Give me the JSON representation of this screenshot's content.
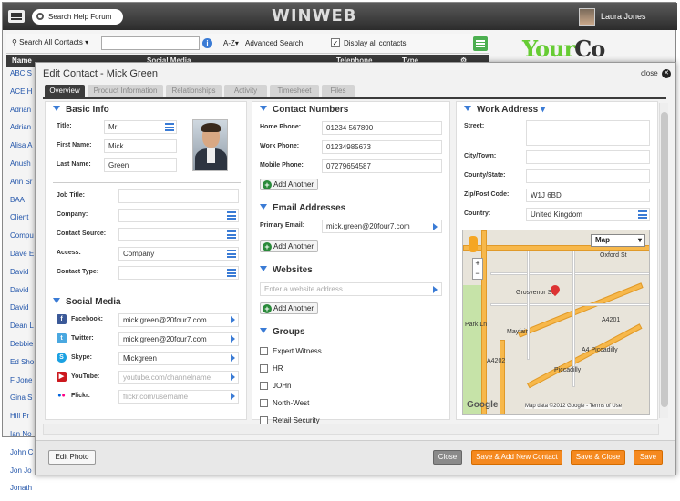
{
  "app": {
    "search_forum": "Search Help Forum",
    "logo": "WINWEB",
    "user_name": "Laura Jones",
    "brand_a": "Your",
    "brand_b": "Co"
  },
  "toolbar": {
    "search_label": "Search All Contacts",
    "az": "A-Z",
    "advanced": "Advanced Search",
    "display_all": "Display all contacts",
    "info": "i"
  },
  "grid": {
    "columns": [
      "Name",
      "Social Media",
      "Telephone",
      "Type"
    ],
    "names": [
      "ABC S",
      "ACE H",
      "Adrian",
      "Adrian",
      "Alisa A",
      "Anush",
      "Ann Sr",
      "BAA",
      "Client",
      "Compu",
      "Dave E",
      "David",
      "David",
      "David",
      "Dean L",
      "Debbie",
      "Ed Sho",
      "F Jone",
      "Gina S",
      "Hill Pr",
      "Ian No",
      "John C",
      "Jon Jo",
      "Jonath"
    ]
  },
  "modal": {
    "title": "Edit Contact - Mick Green",
    "close": "close",
    "tabs": [
      "Overview",
      "Product Information",
      "Relationships",
      "Activity",
      "Timesheet",
      "Files"
    ],
    "basic_info": {
      "title": "Basic Info",
      "title_label": "Title:",
      "title_value": "Mr",
      "first_name_label": "First Name:",
      "first_name": "Mick",
      "last_name_label": "Last Name:",
      "last_name": "Green",
      "job_title_label": "Job Title:",
      "company_label": "Company:",
      "contact_source_label": "Contact Source:",
      "access_label": "Access:",
      "access_value": "Company",
      "contact_type_label": "Contact Type:"
    },
    "social_media": {
      "title": "Social Media",
      "facebook_label": "Facebook:",
      "facebook": "mick.green@20four7.com",
      "twitter_label": "Twitter:",
      "twitter": "mick.green@20four7.com",
      "skype_label": "Skype:",
      "skype": "Mickgreen",
      "youtube_label": "YouTube:",
      "youtube_ph": "youtube.com/channelname",
      "flickr_label": "Flickr:",
      "flickr_ph": "flickr.com/username"
    },
    "contact_numbers": {
      "title": "Contact Numbers",
      "home_label": "Home Phone:",
      "home": "01234 567890",
      "work_label": "Work Phone:",
      "work": "01234985673",
      "mobile_label": "Mobile Phone:",
      "mobile": "07279654587",
      "add": "Add Another"
    },
    "email": {
      "title": "Email Addresses",
      "primary_label": "Primary Email:",
      "primary": "mick.green@20four7.com",
      "add": "Add Another"
    },
    "websites": {
      "title": "Websites",
      "placeholder": "Enter a website address",
      "add": "Add Another"
    },
    "groups": {
      "title": "Groups",
      "items": [
        "Expert Witness",
        "HR",
        "JOHn",
        "North-West",
        "Retail Security"
      ]
    },
    "work_address": {
      "title": "Work Address",
      "street_label": "Street:",
      "city_label": "City/Town:",
      "county_label": "County/State:",
      "zip_label": "Zip/Post Code:",
      "zip": "W1J 6BD",
      "country_label": "Country:",
      "country": "United Kingdom"
    },
    "map": {
      "type": "Map",
      "labels": [
        "Oxford St",
        "Grosvenor St",
        "Mayfair",
        "A4201",
        "A4 Piccadilly",
        "Piccadilly",
        "A4202",
        "Park Ln"
      ],
      "attribution": "Map data ©2012 Google - Terms of Use",
      "google": "Google"
    },
    "footer": {
      "edit_photo": "Edit Photo",
      "close": "Close",
      "save_add": "Save & Add New Contact",
      "save_close": "Save & Close",
      "save": "Save"
    }
  }
}
